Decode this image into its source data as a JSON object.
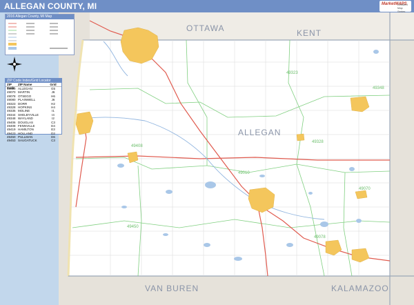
{
  "header": {
    "title": "ALLEGAN COUNTY, MI",
    "logo_main": "MarketMAPS",
    "logo_sub": "Detailed Map Series"
  },
  "legend": {
    "title": "2016 Allegan County, MI Map"
  },
  "zip_table": {
    "title": "ZIP Code Index/Grid Locator",
    "columns": [
      "ZIP Code",
      "ZIP Name",
      "Grid"
    ],
    "rows": [
      [
        "49010",
        "ALLEGAN",
        "G5"
      ],
      [
        "49070",
        "MARTIN",
        "J6"
      ],
      [
        "49078",
        "OTSEGO",
        "H6"
      ],
      [
        "49080",
        "PLAINWELL",
        "J6"
      ],
      [
        "49323",
        "DORR",
        "H2"
      ],
      [
        "49328",
        "HOPKINS",
        "H4"
      ],
      [
        "49335",
        "MOLINE",
        "I1"
      ],
      [
        "49344",
        "SHELBYVILLE",
        "I4"
      ],
      [
        "49348",
        "WAYLAND",
        "I2"
      ],
      [
        "49406",
        "DOUGLAS",
        "C3"
      ],
      [
        "49408",
        "FENNVILLE",
        "D4"
      ],
      [
        "49419",
        "HAMILTON",
        "E3"
      ],
      [
        "49423",
        "HOLLAND",
        "D2"
      ],
      [
        "49450",
        "PULLMAN",
        "D6"
      ],
      [
        "49453",
        "SAUGATUCK",
        "C3"
      ]
    ]
  },
  "map": {
    "labels": {
      "ottawa": "OTTAWA",
      "kent": "KENT",
      "allegan": "ALLEGAN",
      "van_buren": "VAN BUREN",
      "kalamazoo": "KALAMAZOO"
    },
    "zip_labels": {
      "z49323": "49323",
      "z49348": "49348",
      "z49408": "49408",
      "z49328": "49328",
      "z49010": "49010",
      "z49070": "49070",
      "z49450": "49450",
      "z49078": "49078"
    },
    "colors": {
      "water": "#c2d7ec",
      "county_outside": "#e6e2da",
      "urban": "#f4c65c",
      "road_major": "#e05a4e",
      "road_minor": "#7fcf7f",
      "border": "#9aa7b8"
    }
  }
}
